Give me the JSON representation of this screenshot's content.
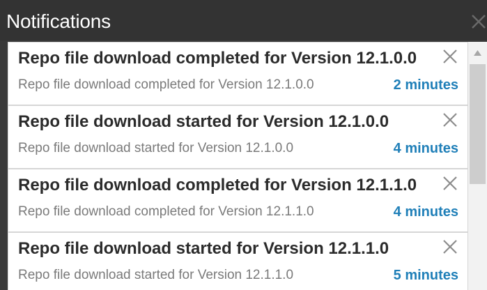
{
  "panel": {
    "title": "Notifications",
    "close_icon": "close-icon"
  },
  "notifications": [
    {
      "title": "Repo file download completed for Version 12.1.0.0",
      "message": "Repo file download completed for Version 12.1.0.0",
      "time": "2 minutes"
    },
    {
      "title": "Repo file download started for Version 12.1.0.0",
      "message": "Repo file download started for Version 12.1.0.0",
      "time": "4 minutes"
    },
    {
      "title": "Repo file download completed for Version 12.1.1.0",
      "message": "Repo file download completed for Version 12.1.1.0",
      "time": "4 minutes"
    },
    {
      "title": "Repo file download started for Version 12.1.1.0",
      "message": "Repo file download started for Version 12.1.1.0",
      "time": "5 minutes"
    }
  ],
  "colors": {
    "header_bg": "#333333",
    "time_accent": "#1f7fb8",
    "title_text": "#2b2b2b",
    "message_text": "#7a7a7a"
  }
}
